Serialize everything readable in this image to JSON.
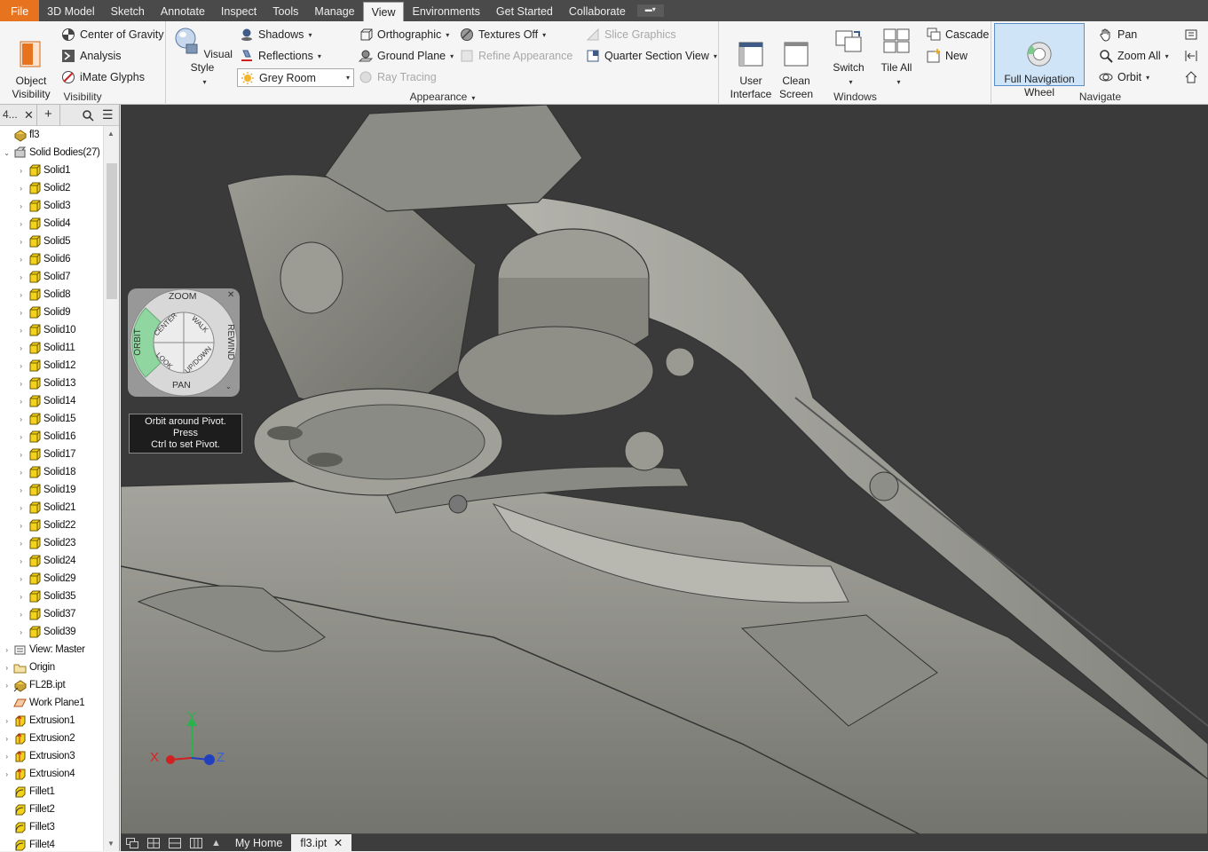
{
  "menu": {
    "tabs": [
      "File",
      "3D Model",
      "Sketch",
      "Annotate",
      "Inspect",
      "Tools",
      "Manage",
      "View",
      "Environments",
      "Get Started",
      "Collaborate"
    ],
    "active": "View",
    "extra_dropdown_icon": "panel-dropdown-icon"
  },
  "ribbon": {
    "visibility": {
      "label": "Visibility",
      "object_visibility": "Object\nVisibility",
      "center_of_gravity": "Center of Gravity",
      "analysis": "Analysis",
      "imate_glyphs": "iMate Glyphs"
    },
    "appearance": {
      "label": "Appearance",
      "visual_style": "Visual Style",
      "shadows": "Shadows",
      "reflections": "Reflections",
      "environment_value": "Grey Room",
      "orthographic": "Orthographic",
      "ground_plane": "Ground Plane",
      "ray_tracing": "Ray Tracing",
      "textures": "Textures Off",
      "refine_appearance": "Refine Appearance",
      "slice_graphics": "Slice Graphics",
      "quarter_section_view": "Quarter Section View"
    },
    "windows": {
      "label": "Windows",
      "user_interface": "User\nInterface",
      "clean_screen": "Clean\nScreen",
      "switch": "Switch",
      "tile_all": "Tile All",
      "cascade": "Cascade",
      "new": "New"
    },
    "navigate": {
      "label": "Navigate",
      "full_navigation_wheel": "Full Navigation\nWheel",
      "pan": "Pan",
      "zoom_all": "Zoom All",
      "orbit": "Orbit"
    }
  },
  "browser": {
    "title_truncated": "4...",
    "root": "fl3",
    "solid_bodies": "Solid Bodies(27)",
    "solids": [
      "Solid1",
      "Solid2",
      "Solid3",
      "Solid4",
      "Solid5",
      "Solid6",
      "Solid7",
      "Solid8",
      "Solid9",
      "Solid10",
      "Solid11",
      "Solid12",
      "Solid13",
      "Solid14",
      "Solid15",
      "Solid16",
      "Solid17",
      "Solid18",
      "Solid19",
      "Solid21",
      "Solid22",
      "Solid23",
      "Solid24",
      "Solid29",
      "Solid35",
      "Solid37",
      "Solid39"
    ],
    "features": [
      "View: Master",
      "Origin",
      "FL2B.ipt",
      "Work Plane1",
      "Extrusion1",
      "Extrusion2",
      "Extrusion3",
      "Extrusion4",
      "Fillet1",
      "Fillet2",
      "Fillet3",
      "Fillet4"
    ]
  },
  "wheel": {
    "zoom": "ZOOM",
    "orbit": "ORBIT",
    "rewind": "REWIND",
    "pan": "PAN",
    "center": "CENTER",
    "walk": "WALK",
    "look": "LOOK",
    "updown": "UP/DOWN"
  },
  "tooltip": {
    "line1": "Orbit around Pivot. Press",
    "line2": "Ctrl to set Pivot."
  },
  "axes": {
    "x": "X",
    "y": "Y",
    "z": "Z"
  },
  "doc_tabs": {
    "home": "My Home",
    "file": "fl3.ipt"
  },
  "colors": {
    "accent_file": "#e8731f",
    "active_button": "#cfe4f7",
    "viewport_bg": "#3a3a3a",
    "model_gray": "#8a8a82"
  }
}
